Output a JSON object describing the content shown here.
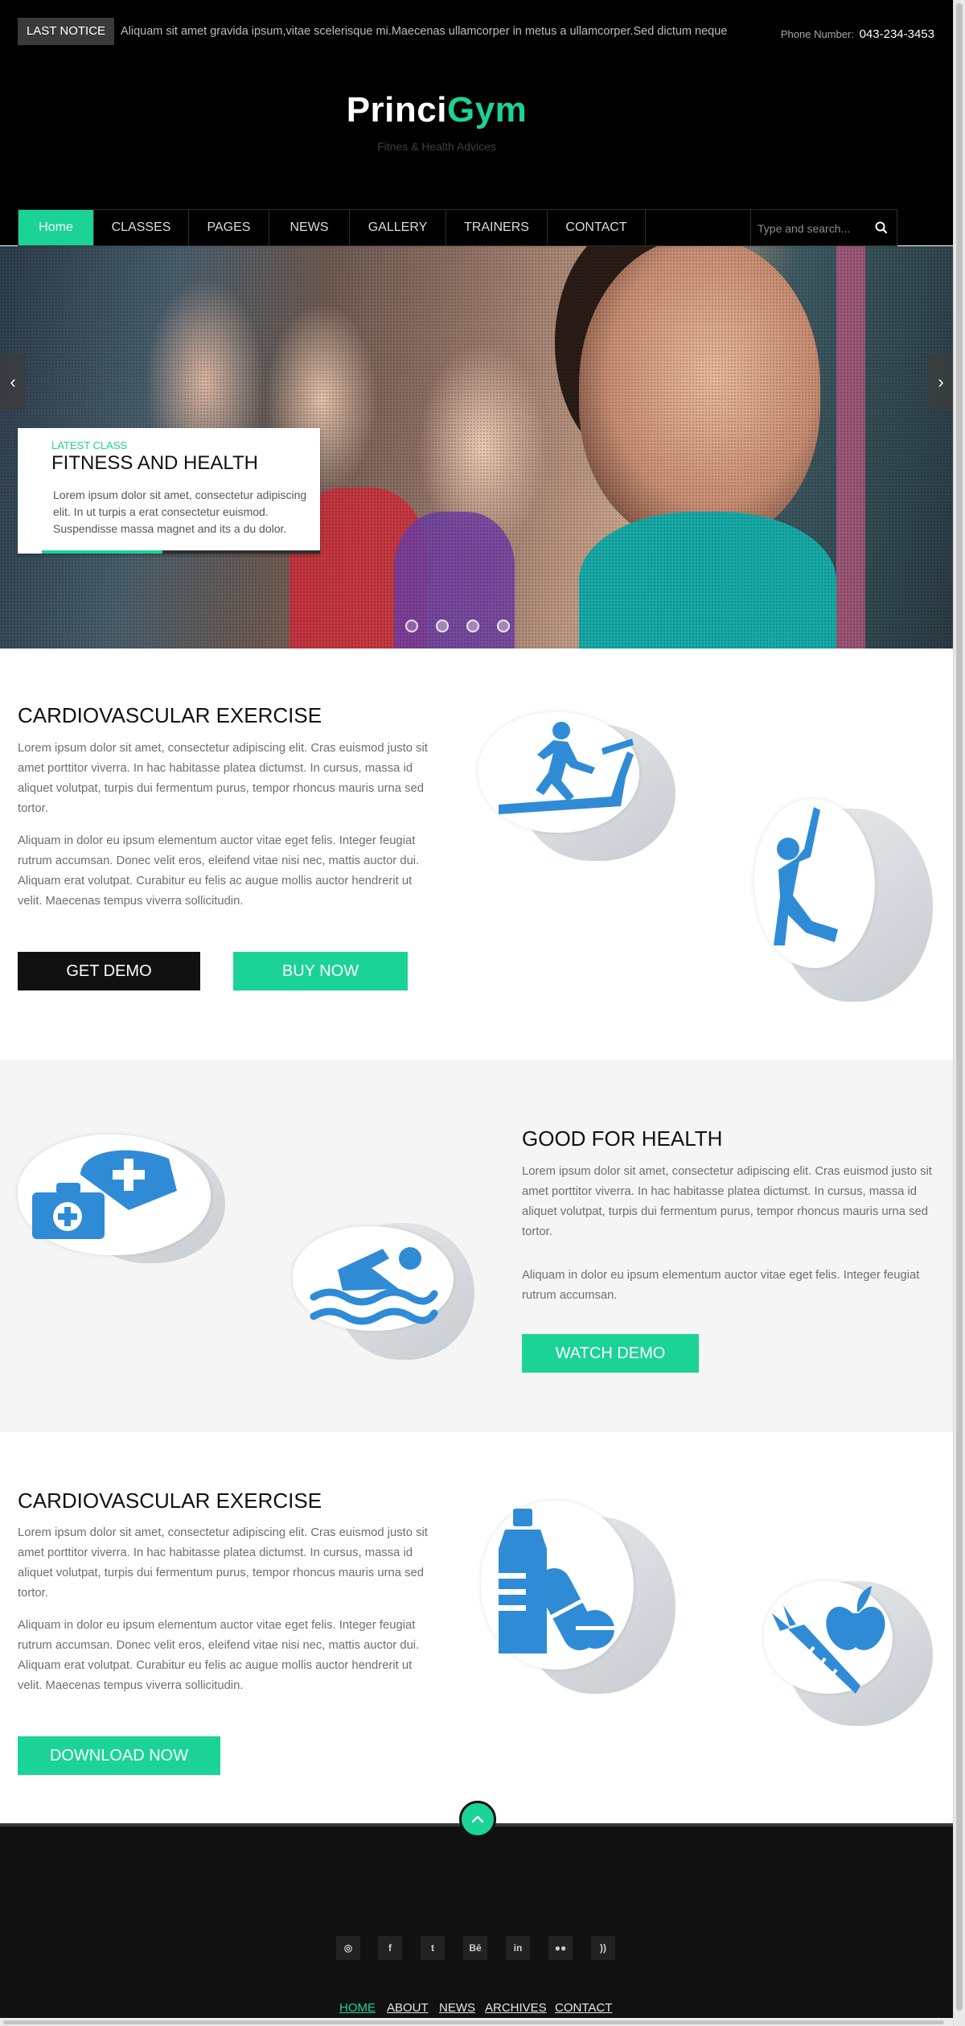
{
  "topbar": {
    "notice_label": "LAST NOTICE",
    "notice_text": "Aliquam sit amet gravida ipsum,vitae scelerisque mi.Maecenas ullamcorper in metus a ullamcorper.Sed dictum neque",
    "phone_label": "Phone Number:",
    "phone_number": "043-234-3453"
  },
  "brand": {
    "logo_part1": "Princi",
    "logo_part2": "Gym",
    "tagline": "Fitnes & Health Advices"
  },
  "nav": {
    "items": [
      "Home",
      "CLASSES",
      "PAGES",
      "NEWS",
      "GALLERY",
      "TRAINERS",
      "CONTACT"
    ],
    "active_index": 0,
    "search_placeholder": "Type and search..."
  },
  "hero": {
    "prev_arrow": "‹",
    "next_arrow": "›",
    "caption_label": "LATEST CLASS",
    "caption_title": "FITNESS AND HEALTH",
    "caption_text": "Lorem ipsum dolor sit amet, consectetur adipiscing\nelit. In ut turpis a erat consectetur euismod.\nSuspendisse massa magnet and its a du dolor.",
    "slide_count": 4,
    "active_slide": 0
  },
  "section1": {
    "title": "CARDIOVASCULAR EXERCISE",
    "para1": "Lorem ipsum dolor sit amet, consectetur adipiscing elit. Cras euismod justo sit amet porttitor viverra. In hac habitasse platea dictumst. In cursus, massa id aliquet volutpat, turpis dui fermentum purus, tempor rhoncus mauris urna sed tortor.",
    "para2": "Aliquam in dolor eu ipsum elementum auctor vitae eget felis. Integer feugiat rutrum accumsan. Donec velit eros, eleifend vitae nisi nec, mattis auctor dui. Aliquam erat volutpat. Curabitur eu felis ac augue mollis auctor hendrerit ut velit. Maecenas tempus viverra sollicitudin.",
    "btn_demo": "GET DEMO",
    "btn_buy": "BUY NOW",
    "icons": [
      "treadmill-icon",
      "stretching-person-icon"
    ]
  },
  "section2": {
    "title": "GOOD FOR HEALTH",
    "para1": "Lorem ipsum dolor sit amet, consectetur adipiscing elit. Cras euismod justo sit amet porttitor viverra. In hac habitasse platea dictumst. In cursus, massa id aliquet volutpat, turpis dui fermentum purus, tempor rhoncus mauris urna sed tortor.",
    "para2": "Aliquam in dolor eu ipsum elementum auctor vitae eget felis. Integer feugiat rutrum accumsan.",
    "btn_watch": "WATCH DEMO",
    "icons": [
      "first-aid-kit-icon",
      "swimmer-icon"
    ]
  },
  "section3": {
    "title": "CARDIOVASCULAR EXERCISE",
    "para1": "Lorem ipsum dolor sit amet, consectetur adipiscing elit. Cras euismod justo sit amet porttitor viverra. In hac habitasse platea dictumst. In cursus, massa id aliquet volutpat, turpis dui fermentum purus, tempor rhoncus mauris urna sed tortor.",
    "para2": "Aliquam in dolor eu ipsum elementum auctor vitae eget felis. Integer feugiat rutrum accumsan. Donec velit eros, eleifend vitae nisi nec, mattis auctor dui. Aliquam erat volutpat. Curabitur eu felis ac augue mollis auctor hendrerit ut velit. Maecenas tempus viverra sollicitudin.",
    "btn_download": "DOWNLOAD NOW",
    "icons": [
      "water-bottle-pills-icon",
      "carrot-apple-icon"
    ]
  },
  "footer": {
    "back_to_top_icon": "chevron-up-icon",
    "socials": [
      {
        "icon": "dribbble-icon",
        "glyph": "◎"
      },
      {
        "icon": "facebook-icon",
        "glyph": "f"
      },
      {
        "icon": "twitter-icon",
        "glyph": "t"
      },
      {
        "icon": "behance-icon",
        "glyph": "Bē"
      },
      {
        "icon": "linkedin-icon",
        "glyph": "in"
      },
      {
        "icon": "flickr-icon",
        "glyph": "●●"
      },
      {
        "icon": "rss-icon",
        "glyph": "))"
      }
    ],
    "links": [
      "HOME",
      "ABOUT",
      "NEWS",
      "ARCHIVES",
      "CONTACT"
    ],
    "active_link": 0
  },
  "colors": {
    "accent": "#1bd396",
    "icon_blue": "#2f8bd6",
    "header_bg": "#000000",
    "footer_bg": "#111111"
  }
}
